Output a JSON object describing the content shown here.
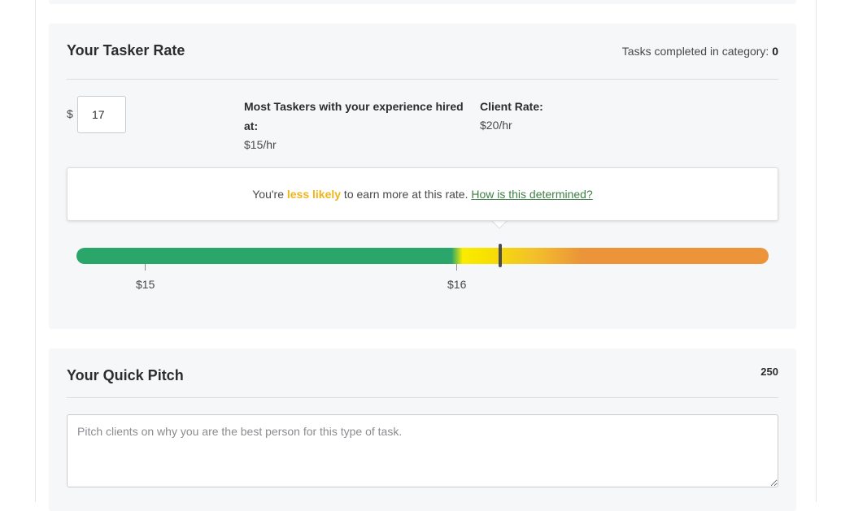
{
  "rate_card": {
    "title": "Your Tasker Rate",
    "tasks_completed_label": "Tasks completed in category:",
    "tasks_completed_count": "0",
    "currency_symbol": "$",
    "rate_value": "17",
    "experience_label": "Most Taskers with your experience hired at:",
    "experience_value": "$15/hr",
    "client_rate_label": "Client Rate:",
    "client_rate_value": "$20/hr",
    "hint": {
      "prefix": "You're ",
      "emphasis": "less likely",
      "suffix": " to earn more at this rate.",
      "link": "How is this determined?"
    },
    "meter": {
      "ticks": [
        "$15",
        "$16"
      ],
      "colors": {
        "low": "#2ba66a",
        "mid": "#f9ec00",
        "high": "#eb943a"
      }
    }
  },
  "pitch_card": {
    "title": "Your Quick Pitch",
    "char_count": "250",
    "placeholder": "Pitch clients on why you are the best person for this type of task."
  }
}
